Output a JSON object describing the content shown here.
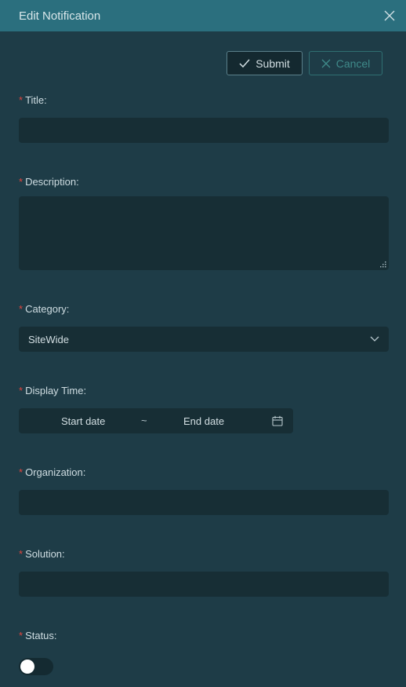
{
  "dialog": {
    "title": "Edit Notification"
  },
  "actions": {
    "submit_label": "Submit",
    "cancel_label": "Cancel"
  },
  "form": {
    "title_label": "Title:",
    "title_value": "",
    "description_label": "Description:",
    "description_value": "",
    "category_label": "Category:",
    "category_value": "SiteWide",
    "display_time_label": "Display Time:",
    "start_date_placeholder": "Start date",
    "range_separator": "~",
    "end_date_placeholder": "End date",
    "organization_label": "Organization:",
    "organization_value": "",
    "solution_label": "Solution:",
    "solution_value": "",
    "status_label": "Status:",
    "status_on": false
  },
  "required_marker": "*",
  "icons": {
    "close": "close-icon",
    "submit": "check-icon",
    "cancel": "x-icon",
    "select": "chevron-down-icon",
    "date": "calendar-icon"
  },
  "colors": {
    "header": "#2b6f7e",
    "panel": "#1e3c47",
    "field": "#172e35",
    "required": "#e0453d",
    "cancel_accent": "#3f8a8a"
  }
}
